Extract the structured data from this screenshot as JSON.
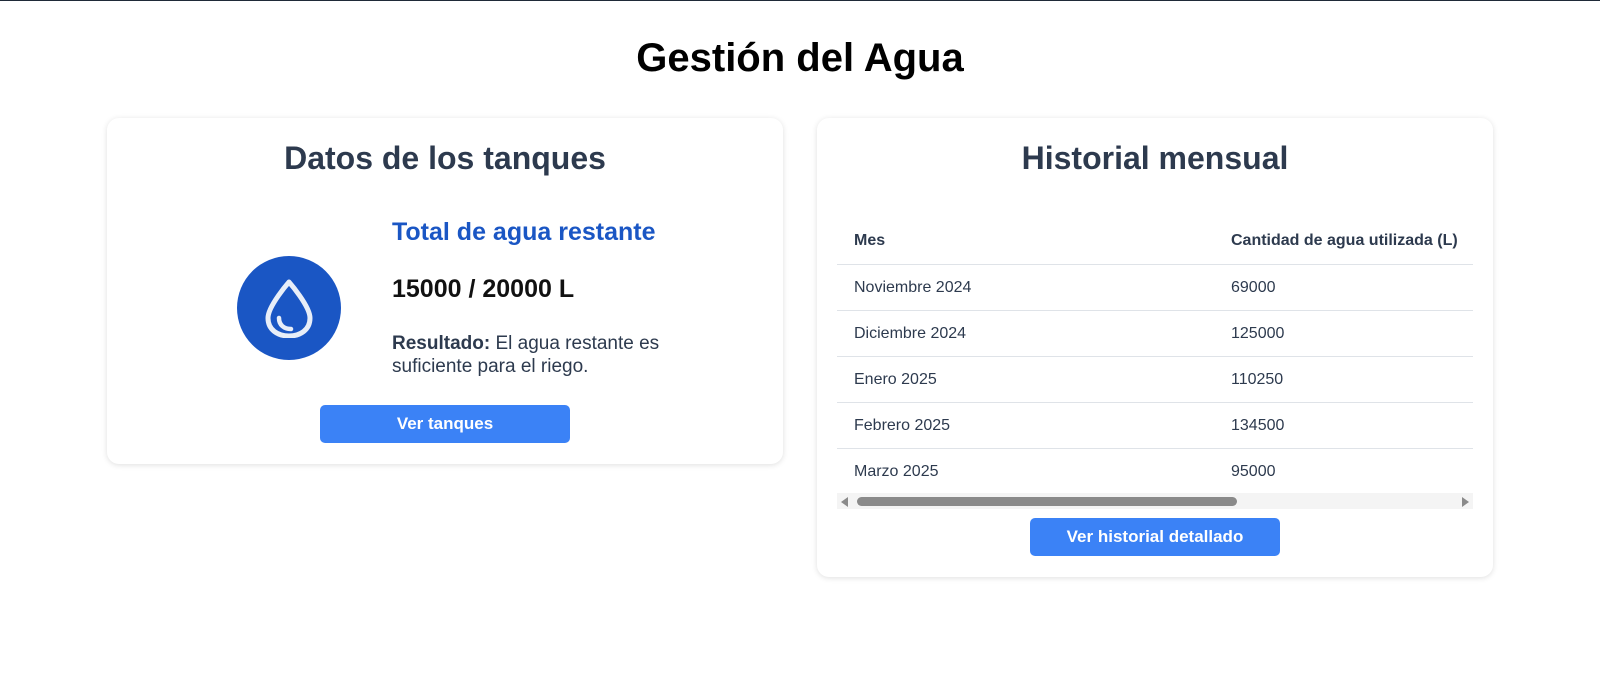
{
  "page": {
    "title": "Gestión del Agua"
  },
  "tanks_card": {
    "title": "Datos de los tanques",
    "icon": "water-drop-icon",
    "heading": "Total de agua restante",
    "amount": "15000 / 20000 L",
    "result_label": "Resultado:",
    "result_text": " El agua restante es suficiente para el riego.",
    "button_label": "Ver tanques"
  },
  "history_card": {
    "title": "Historial mensual",
    "columns": [
      "Mes",
      "Cantidad de agua utilizada (L)"
    ],
    "rows": [
      [
        "Noviembre 2024",
        "69000"
      ],
      [
        "Diciembre 2024",
        "125000"
      ],
      [
        "Enero 2025",
        "110250"
      ],
      [
        "Febrero 2025",
        "134500"
      ],
      [
        "Marzo 2025",
        "95000"
      ]
    ],
    "button_label": "Ver historial detallado"
  },
  "colors": {
    "accent_blue": "#1a56c4",
    "button_blue": "#3b82f6",
    "text_dark": "#2d3a4e"
  }
}
